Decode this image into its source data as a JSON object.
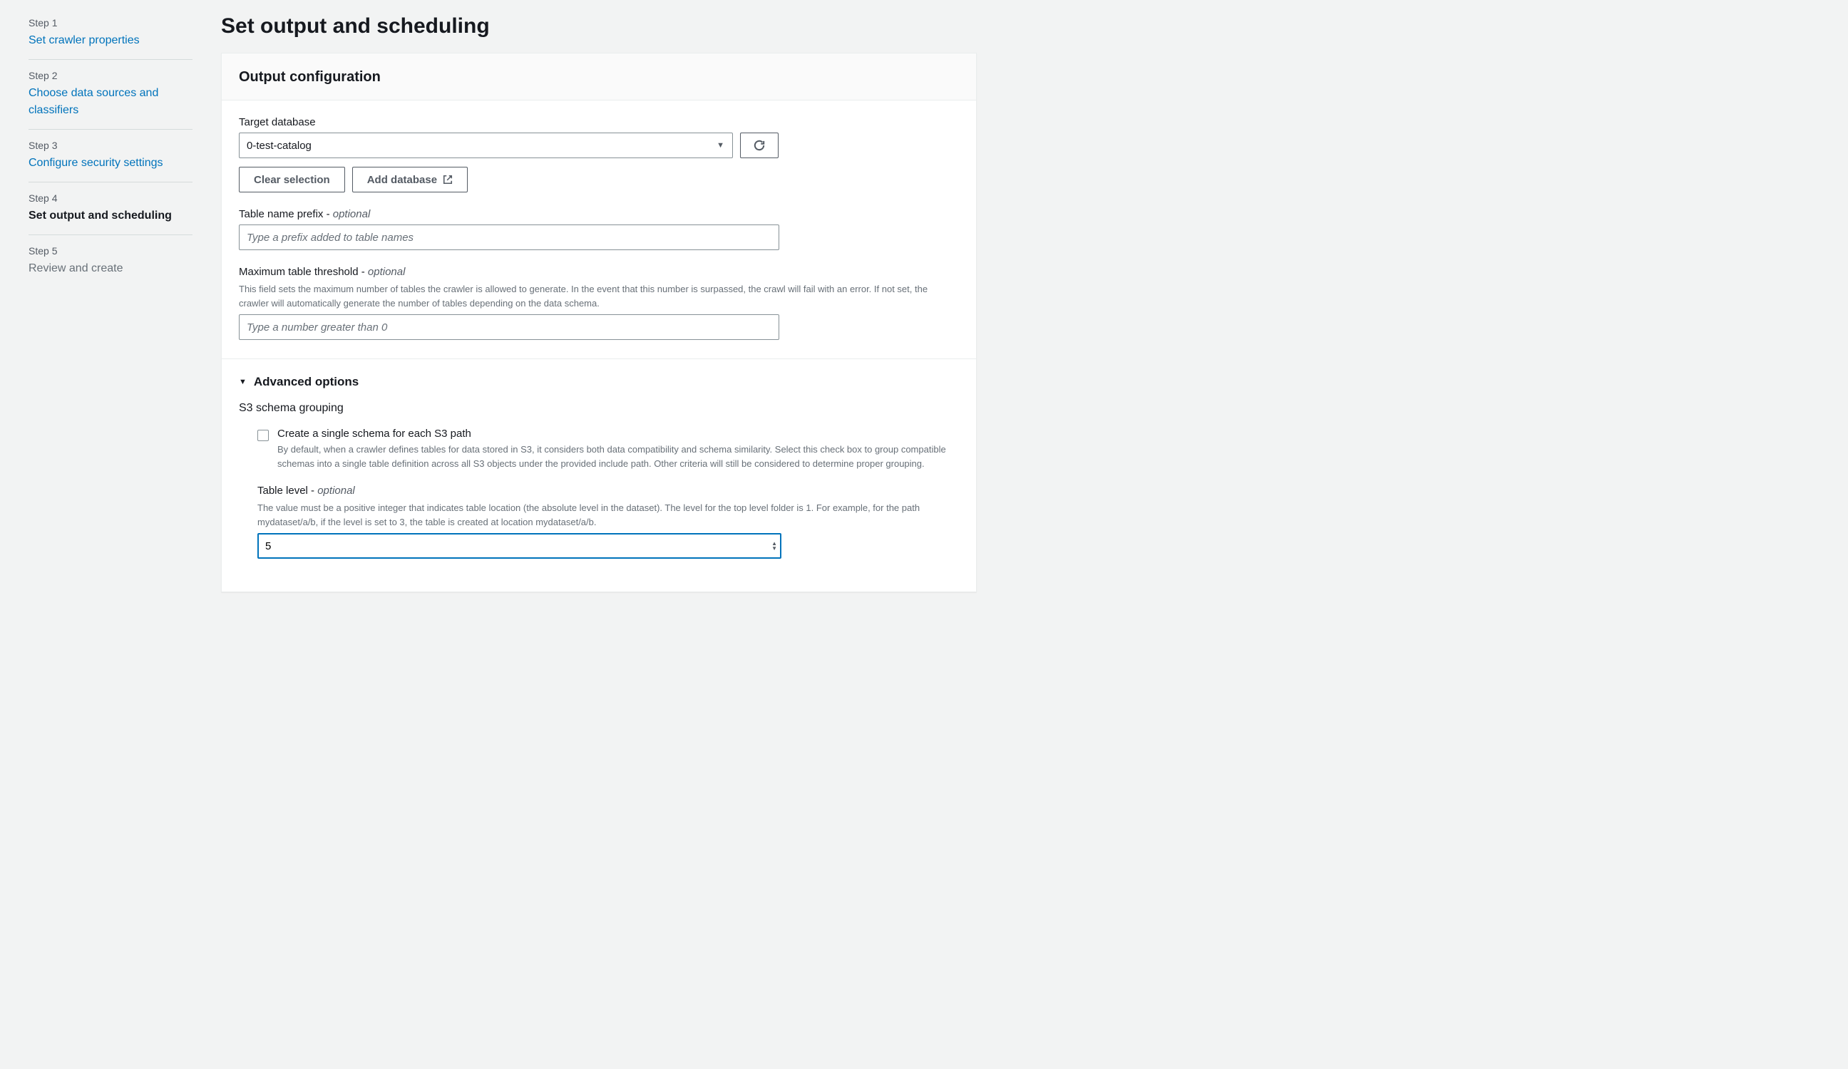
{
  "sidebar": {
    "steps": [
      {
        "number": "Step 1",
        "title": "Set crawler properties",
        "state": "link"
      },
      {
        "number": "Step 2",
        "title": "Choose data sources and classifiers",
        "state": "link"
      },
      {
        "number": "Step 3",
        "title": "Configure security settings",
        "state": "link"
      },
      {
        "number": "Step 4",
        "title": "Set output and scheduling",
        "state": "active"
      },
      {
        "number": "Step 5",
        "title": "Review and create",
        "state": "disabled"
      }
    ]
  },
  "page": {
    "title": "Set output and scheduling"
  },
  "output_config": {
    "header": "Output configuration",
    "target_database": {
      "label": "Target database",
      "selected": "0-test-catalog",
      "clear_button": "Clear selection",
      "add_button": "Add database"
    },
    "table_prefix": {
      "label": "Table name prefix - ",
      "optional": "optional",
      "placeholder": "Type a prefix added to table names",
      "value": ""
    },
    "max_threshold": {
      "label": "Maximum table threshold - ",
      "optional": "optional",
      "hint": "This field sets the maximum number of tables the crawler is allowed to generate. In the event that this number is surpassed, the crawl will fail with an error. If not set, the crawler will automatically generate the number of tables depending on the data schema.",
      "placeholder": "Type a number greater than 0",
      "value": ""
    }
  },
  "advanced": {
    "title": "Advanced options",
    "s3_grouping": {
      "title": "S3 schema grouping",
      "checkbox_label": "Create a single schema for each S3 path",
      "checkbox_hint": "By default, when a crawler defines tables for data stored in S3, it considers both data compatibility and schema similarity. Select this check box to group compatible schemas into a single table definition across all S3 objects under the provided include path. Other criteria will still be considered to determine proper grouping.",
      "checkbox_checked": false
    },
    "table_level": {
      "label": "Table level - ",
      "optional": "optional",
      "hint": "The value must be a positive integer that indicates table location (the absolute level in the dataset). The level for the top level folder is 1. For example, for the path mydataset/a/b, if the level is set to 3, the table is created at location mydataset/a/b.",
      "value": "5"
    }
  }
}
